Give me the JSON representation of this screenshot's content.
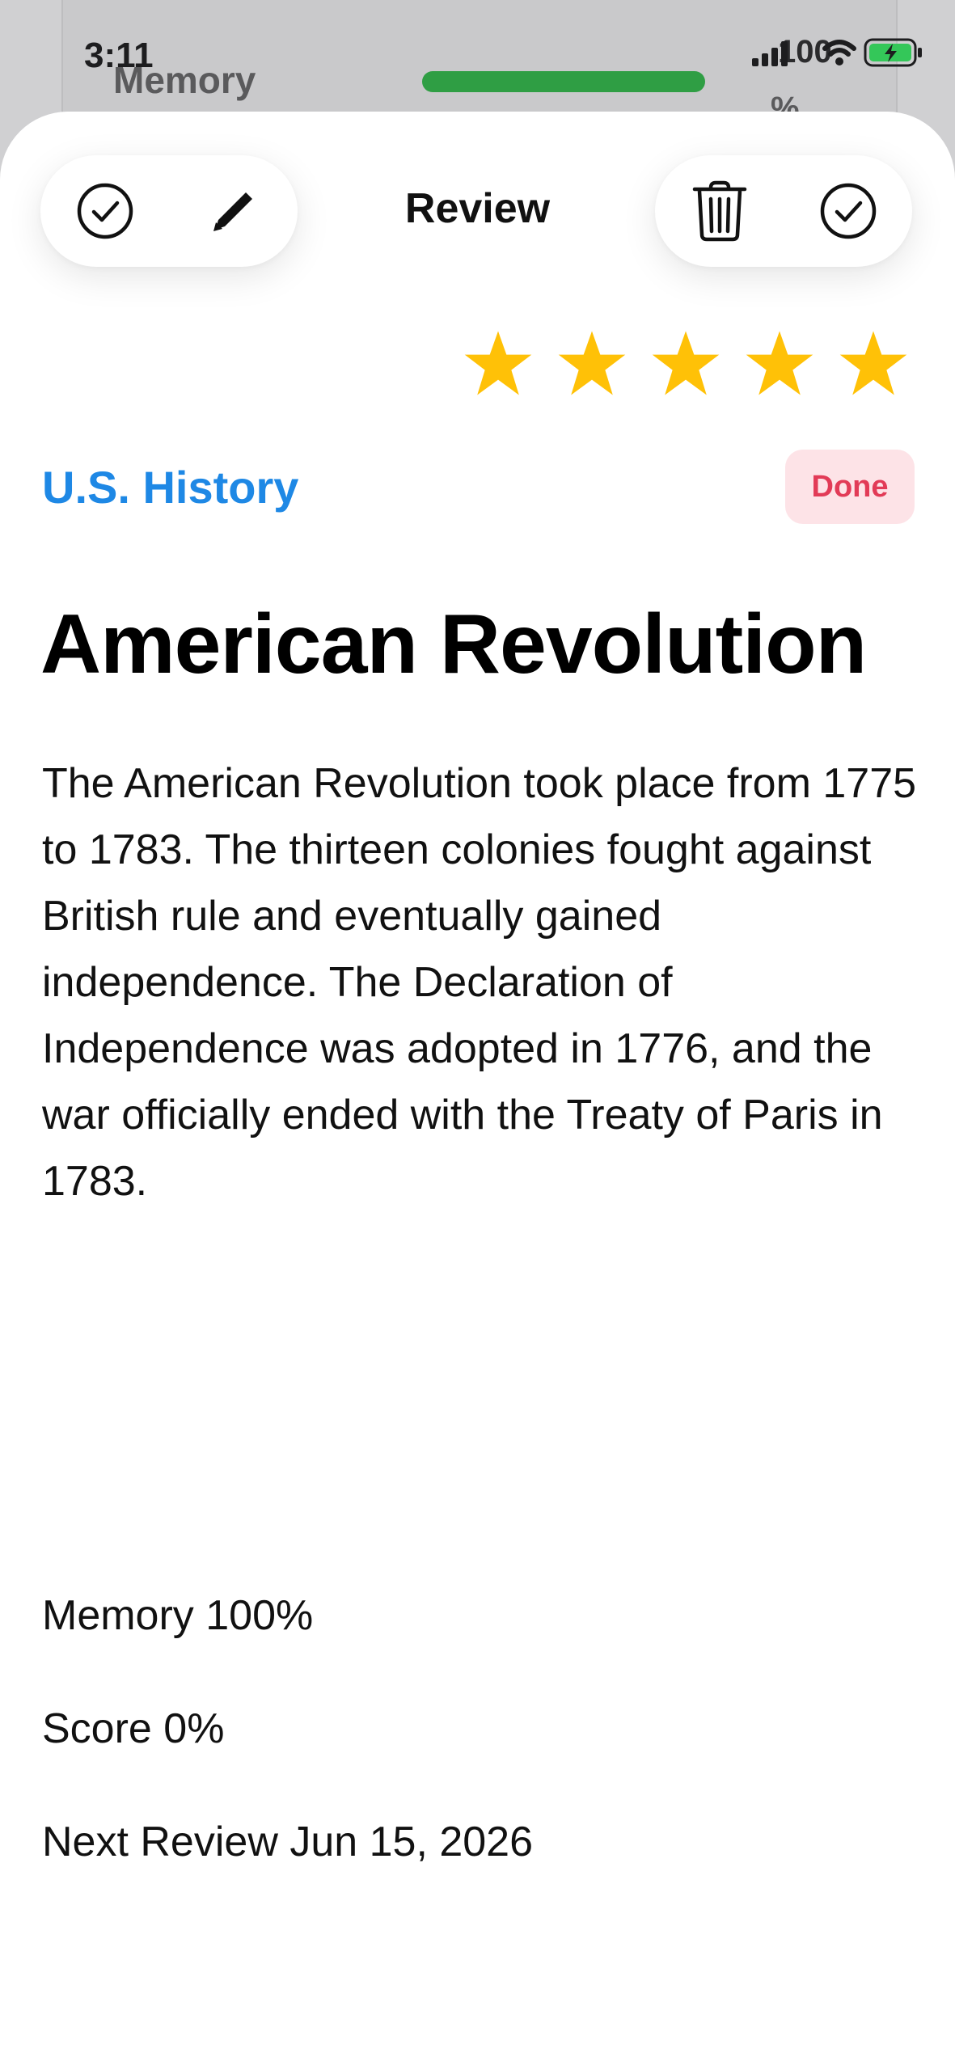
{
  "status_bar": {
    "time": "3:11",
    "battery_text": "100",
    "battery_color": "#34c759",
    "indicator_color": "#2f9e44"
  },
  "background": {
    "title": "Memory",
    "pct": "%"
  },
  "toolbar": {
    "title": "Review",
    "left_buttons": [
      "check-circle-icon",
      "pencil-icon"
    ],
    "right_buttons": [
      "trash-icon",
      "check-circle-icon"
    ]
  },
  "rating": {
    "stars": 5,
    "max": 5,
    "color": "#ffc107"
  },
  "card": {
    "category": "U.S. History",
    "category_color": "#1e88e5",
    "status_badge": "Done",
    "title": "American Revolution",
    "body": "The American Revolution took place from 1775 to 1783. The thirteen colonies fought against British rule and eventually gained independence. The Declaration of Independence was adopted in 1776, and the war officially ended with the Treaty of Paris in 1783."
  },
  "stats": {
    "memory": "Memory 100%",
    "score": "Score 0%",
    "next_review": "Next Review Jun 15, 2026"
  }
}
